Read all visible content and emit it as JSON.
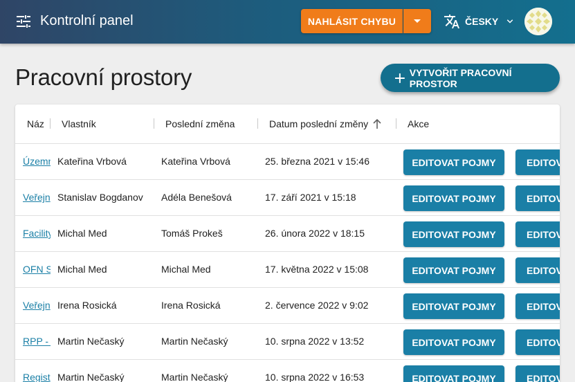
{
  "header": {
    "title": "Kontrolní panel",
    "report_label": "NAHLÁSIT CHYBU",
    "language_label": "ČESKY",
    "menu_icon": "tune-icon",
    "language_icon": "translate-icon"
  },
  "page": {
    "title": "Pracovní prostory",
    "create_label": "VYTVOŘIT PRACOVNÍ PROSTOR"
  },
  "table": {
    "columns": [
      "Náz",
      "Vlastník",
      "Poslední změna",
      "Datum poslední změny",
      "Akce"
    ],
    "sort_column": "Datum poslední změny",
    "sort_direction": "ascending",
    "rows": [
      {
        "name": "Územn",
        "owner": "Kateřina Vrbová",
        "last": "Kateřina Vrbová",
        "date": "25. března 2021 v 15:46",
        "action1": "EDITOVAT POJMY",
        "action2": "EDITOV"
      },
      {
        "name": "Veřejn",
        "owner": "Stanislav Bogdanov",
        "last": "Adéla Benešová",
        "date": "17. září 2021 v 15:18",
        "action1": "EDITOVAT POJMY",
        "action2": "EDITOV"
      },
      {
        "name": "Facility",
        "owner": "Michal Med",
        "last": "Tomáš Prokeš",
        "date": "26. února 2022 v 18:15",
        "action1": "EDITOVAT POJMY",
        "action2": "EDITOV"
      },
      {
        "name": "OFN S",
        "owner": "Michal Med",
        "last": "Michal Med",
        "date": "17. května 2022 v 15:08",
        "action1": "EDITOVAT POJMY",
        "action2": "EDITOV"
      },
      {
        "name": "Veřejn",
        "owner": "Irena Rosická",
        "last": "Irena Rosická",
        "date": "2. července 2022 v 9:02",
        "action1": "EDITOVAT POJMY",
        "action2": "EDITOV"
      },
      {
        "name": "RPP - r",
        "owner": "Martin Nečaský",
        "last": "Martin Nečaský",
        "date": "10. srpna 2022 v 13:52",
        "action1": "EDITOVAT POJMY",
        "action2": "EDITOV"
      },
      {
        "name": "Regist",
        "owner": "Martin Nečaský",
        "last": "Martin Nečaský",
        "date": "10. srpna 2022 v 16:53",
        "action1": "EDITOVAT POJMY",
        "action2": "EDITOV"
      }
    ]
  },
  "colors": {
    "header_start": "#2f4566",
    "header_end": "#136f8e",
    "report_button": "#f07c1a",
    "primary": "#136f8e",
    "action_button": "#1a7fa6",
    "link": "#1a7fa6"
  }
}
